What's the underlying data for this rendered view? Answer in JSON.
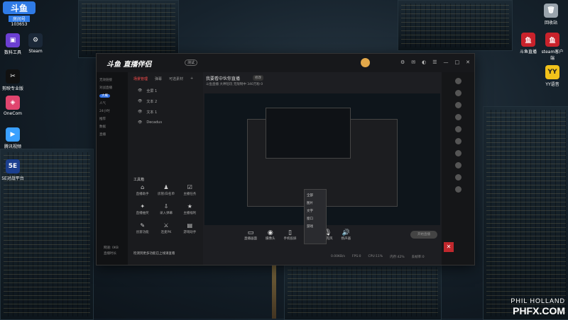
{
  "desktop_icons_left": [
    {
      "label": "斗鱼",
      "sub": "房间号",
      "num": "103653",
      "color": "#2f7be6"
    },
    {
      "label": "数科工具",
      "color": "#6c3fd3"
    },
    {
      "label": "Steam",
      "color": "#1b2838"
    },
    {
      "label": "剪映专业版",
      "color": "#111111"
    },
    {
      "label": "OneCom",
      "color": "#e0456e"
    },
    {
      "label": "腾讯视频",
      "color": "#3aa0ff"
    },
    {
      "label": "5E对战平台",
      "color": "#1b3f8f"
    }
  ],
  "desktop_icons_right": [
    {
      "label": "回收站",
      "color": "#9aa4ad"
    },
    {
      "label": "斗鱼直播",
      "color": "#c9222b"
    },
    {
      "label": "steam客户端",
      "color": "#c9222b"
    },
    {
      "label": "YY语音",
      "color": "#f2c21a"
    }
  ],
  "window": {
    "logo": "斗鱼 直播伴侣",
    "version": "测试",
    "tabs": [
      "场景管理",
      "弹幕",
      "可选素材"
    ],
    "scene_items": [
      "全屏 1",
      "文本 2",
      "文本 1",
      "Decadus"
    ],
    "toolbox_title": "工具箱",
    "tools": [
      "直播助手",
      "房管/白名单",
      "主播任务",
      "直播抽奖",
      "录入弹幕",
      "主播福利",
      "创意功能",
      "连麦PK",
      "游戏助手"
    ],
    "left_strip": [
      "无效链接",
      "对战直播",
      "大概",
      "人气",
      "24小时",
      "推荐",
      "数据",
      "直播"
    ],
    "room_title": "我要看中伙你直播",
    "room_tag": "修改",
    "room_info": "斗鱼直播  大神陪玩  无限制中  340万粉  0",
    "bottom_tools": [
      "直播画面",
      "摄像头",
      "手机投屏",
      "媒体源",
      "麦克风",
      "扬声器"
    ],
    "start_button": "开始直播",
    "status": [
      "0.00KB/s",
      "FPS:0",
      "CPU:11%",
      "内存:42%",
      "丢帧率:0"
    ],
    "menu_items": [
      "全部",
      "图片",
      "文字",
      "窗口",
      "游戏"
    ],
    "notice": "检测到更多功能已上线请查看",
    "left_status": [
      "网速: 0KB",
      "直播时长"
    ]
  },
  "watermark": {
    "line1": "PHIL HOLLAND",
    "line2": "PHFX.COM"
  }
}
